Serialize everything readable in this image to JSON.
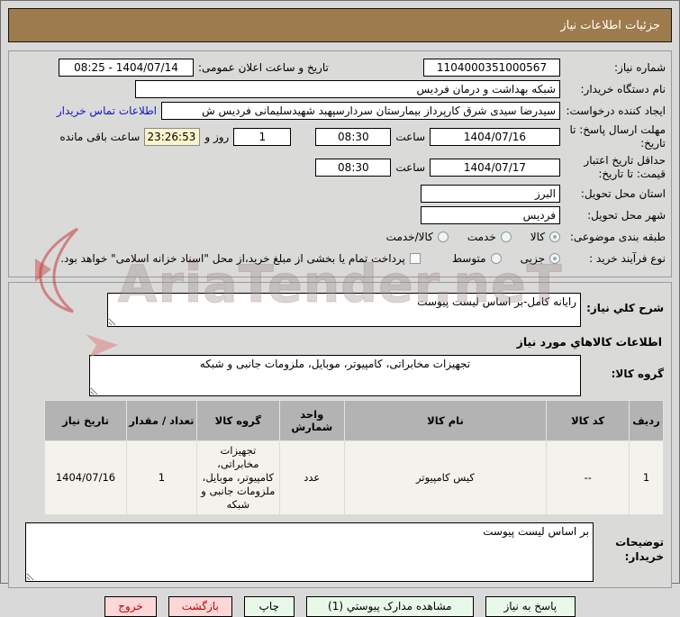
{
  "title_bar": {
    "title": "جزئیات اطلاعات نیاز"
  },
  "form": {
    "need_number": {
      "label": "شماره نیاز:",
      "value": "1104000351000567"
    },
    "announce_datetime": {
      "label": "تاریخ و ساعت اعلان عمومی:",
      "value": "1404/07/14 - 08:25"
    },
    "buyer_org": {
      "label": "نام دستگاه خریدار:",
      "value": "شبکه بهداشت و درمان فردیس"
    },
    "request_creator": {
      "label": "ایجاد کننده درخواست:",
      "value": "سیدرضا سیدی شرق کارپرداز بیمارستان سردارسپهبد شهیدسلیمانی فردیس ش",
      "contact_link": "اطلاعات تماس خریدار"
    },
    "response_deadline": {
      "label": "مهلت ارسال پاسخ: تا تاریخ:",
      "date": "1404/07/16",
      "hour_label": "ساعت",
      "time": "08:30",
      "remaining_days": "1",
      "days_label": "روز و",
      "remaining_time": "23:26:53",
      "remaining_label": "ساعت باقی مانده"
    },
    "price_validity": {
      "label": "حداقل تاریخ اعتبار قیمت: تا تاریخ:",
      "date": "1404/07/17",
      "hour_label": "ساعت",
      "time": "08:30"
    },
    "province": {
      "label": "استان محل تحویل:",
      "value": "البرز"
    },
    "city": {
      "label": "شهر محل تحویل:",
      "value": "فردیس"
    },
    "classification": {
      "label": "طبقه بندی موضوعی:",
      "options": [
        "کالا",
        "خدمت",
        "کالا/خدمت"
      ],
      "selected": "کالا"
    },
    "process_type": {
      "label": "نوع فرآیند خرید :",
      "options": [
        "جزیی",
        "متوسط"
      ],
      "selected": "جزیی",
      "treasury_note": "پرداخت تمام یا بخشی از مبلغ خرید،از محل \"اسناد خزانه اسلامی\" خواهد بود."
    }
  },
  "need_description": {
    "label": "شرح کلي نیاز:",
    "value": "رایانه کامل-بر اساس لیست پیوست"
  },
  "goods_section": {
    "header": "اطلاعات کالاهاي مورد نیاز",
    "group_label": "گروه کالا:",
    "group_value": "تجهیزات مخابراتی، کامپیوتر، موبایل، ملزومات جانبی و شبکه"
  },
  "goods_table": {
    "headers": [
      "ردیف",
      "کد کالا",
      "نام کالا",
      "واحد شمارش",
      "گروه کالا",
      "تعداد / مقدار",
      "تاریخ نیاز"
    ],
    "rows": [
      [
        "1",
        "--",
        "کیس کامپیوتر",
        "عدد",
        "تجهیزات مخابراتی، کامپیوتر، موبایل، ملزومات جانبی و شبکه",
        "1",
        "1404/07/16"
      ]
    ]
  },
  "buyer_notes": {
    "label": "توضیحات خریدار:",
    "value": "بر اساس لیست پیوست"
  },
  "actions": [
    {
      "label": "پاسخ به نیاز",
      "type": "green"
    },
    {
      "label": "مشاهده مدارک پیوستي (1)",
      "type": "green"
    },
    {
      "label": "چاپ",
      "type": "green"
    },
    {
      "label": "بازگشت",
      "type": "pink"
    },
    {
      "label": "خروج",
      "type": "pink"
    }
  ],
  "watermark": {
    "text": "AriaTender.neT"
  },
  "colors": {
    "titlebar_bg": "#9d7b4c",
    "page_bg": "#d9d9d9",
    "countdown_bg": "#fcf4cc",
    "table_header_bg": "#b3b3b3",
    "table_row_bg": "#f4f2ec",
    "button_green_bg": "#e9f9e9",
    "button_pink_bg": "#fcd7d7",
    "button_pink_text": "#c00000",
    "link_blue": "#1414cc",
    "watermark_red": "#c23b3b"
  }
}
